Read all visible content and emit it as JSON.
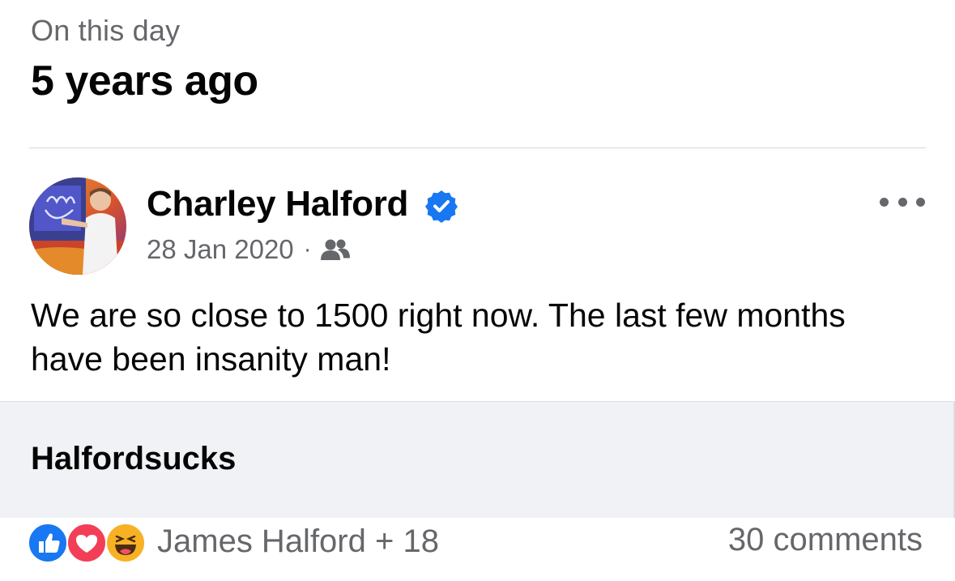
{
  "memory": {
    "label": "On this day",
    "title": "5 years ago"
  },
  "post": {
    "author": "Charley Halford",
    "verified": true,
    "date": "28 Jan 2020",
    "separator": "·",
    "audience_icon": "friends-icon",
    "text": "We are so close to 1500 right now. The last few months have been insanity man!",
    "link_title": "Halfordsucks"
  },
  "footer": {
    "reaction_icons": [
      "like-icon",
      "love-icon",
      "haha-icon"
    ],
    "reactions_text": "James Halford + 18",
    "comments_text": "30 comments"
  },
  "colors": {
    "accent": "#1877f2",
    "text_primary": "#050505",
    "text_secondary": "#65676b",
    "card_bg": "#f0f2f5"
  }
}
